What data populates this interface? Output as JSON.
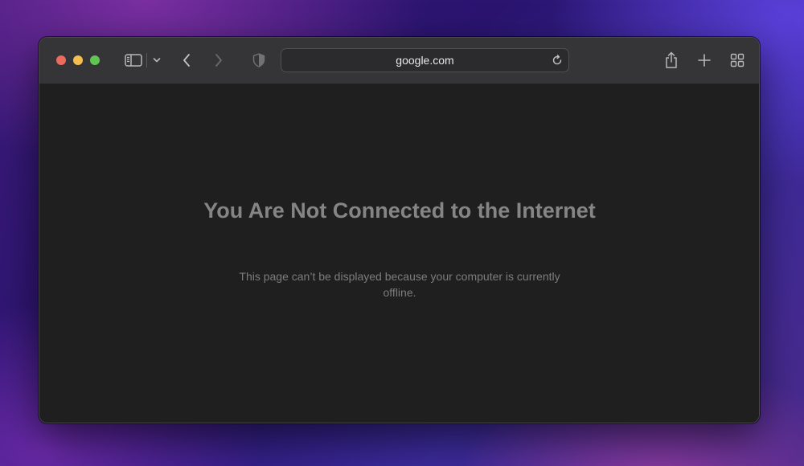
{
  "browser": {
    "address": "google.com",
    "icons": {
      "sidebar": "sidebar-icon",
      "sidebar_menu": "chevron-down-icon",
      "back": "chevron-left-icon",
      "forward": "chevron-right-icon",
      "privacy": "shield-icon",
      "reload": "reload-icon",
      "share": "share-icon",
      "new_tab": "plus-icon",
      "tab_overview": "grid-icon"
    }
  },
  "error_page": {
    "title": "You Are Not Connected to the Internet",
    "message": "This page can’t be displayed because your computer is currently offline."
  },
  "colors": {
    "close": "#ed6a5e",
    "minimize": "#f5bf4f",
    "zoom": "#61c554",
    "toolbar": "#353437",
    "page_background": "#1f1f1f"
  }
}
